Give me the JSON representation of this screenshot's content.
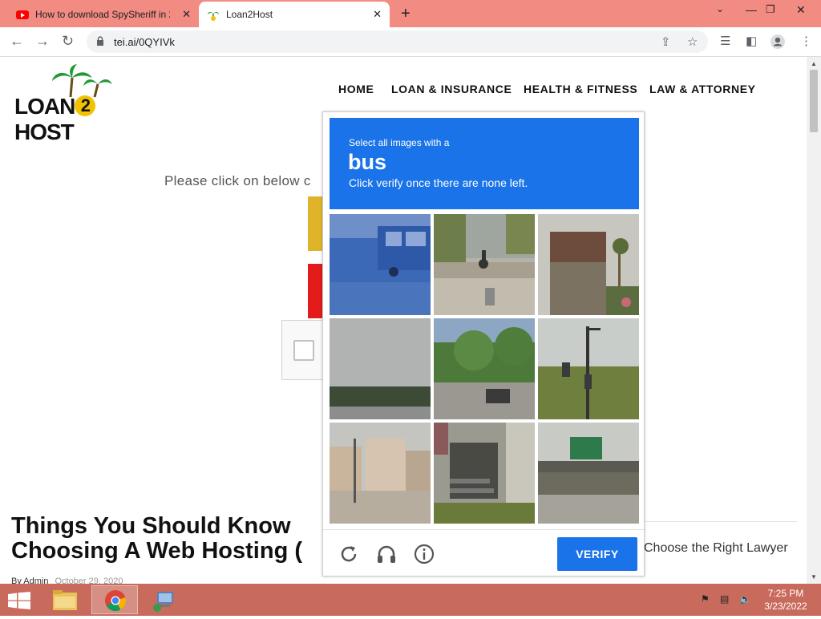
{
  "browser": {
    "tabs": [
      {
        "title": "How to download SpySheriff in 2",
        "active": false,
        "icon": "youtube-icon"
      },
      {
        "title": "Loan2Host",
        "active": true,
        "icon": "palm-favicon"
      }
    ],
    "new_tab_label": "+",
    "url": "tei.ai/0QYIVk",
    "colors": {
      "tabstrip": "#f28b82",
      "taskbar": "#c86a5c"
    }
  },
  "site": {
    "logo_text": "LOAN2HOST",
    "logo_parts": {
      "left": "LOAN",
      "middle": "2",
      "right": "HOST"
    },
    "menu": [
      "HOME",
      "LOAN & INSURANCE",
      "HEALTH & FITNESS",
      "LAW & ATTORNEY"
    ],
    "instruction": "Please click on below c",
    "headline_line1": "Things You Should Know",
    "headline_line2": "Choosing A Web Hosting (",
    "sidebar_link": "Choose the Right Lawyer",
    "byline_author": "By  Admin",
    "byline_date": "October 29, 2020"
  },
  "captcha": {
    "prompt_small": "Select all images with a",
    "target": "bus",
    "instruction": "Click verify once there are none left.",
    "tiles": [
      "blue truck street",
      "cyclist on road",
      "brick building with palm",
      "sky over treeline",
      "car on tree-lined street",
      "traffic light pole",
      "street buildings",
      "house steps with flag",
      "highway sign bridge"
    ],
    "verify_label": "VERIFY",
    "footer_icons": [
      "reload-icon",
      "headphones-icon",
      "info-icon"
    ],
    "accent_color": "#1a73e8"
  },
  "taskbar": {
    "time": "7:25 PM",
    "date": "3/23/2022"
  }
}
